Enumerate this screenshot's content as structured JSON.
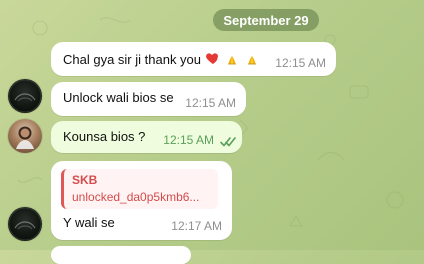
{
  "date_separator": "September 29",
  "messages": [
    {
      "text": "Chal gya sir ji thank you",
      "emojis": [
        "red-heart-icon",
        "folded-hands-icon",
        "folded-hands-icon"
      ],
      "time": "12:15 AM"
    },
    {
      "text": "Unlock wali bios se",
      "time": "12:15 AM"
    },
    {
      "text": "Kounsa bios ?",
      "time": "12:15 AM",
      "status": "read"
    },
    {
      "reply": {
        "title": "SKB",
        "subtitle": "unlocked_da0p5kmb6..."
      },
      "text": "Y wali se",
      "time": "12:17 AM"
    }
  ],
  "colors": {
    "wallpaper": "#b7cd8b",
    "incoming_bubble": "#ffffff",
    "outgoing_bubble": "#effdde",
    "reply_accent": "#e05757",
    "read_tick": "#5aa05a"
  }
}
